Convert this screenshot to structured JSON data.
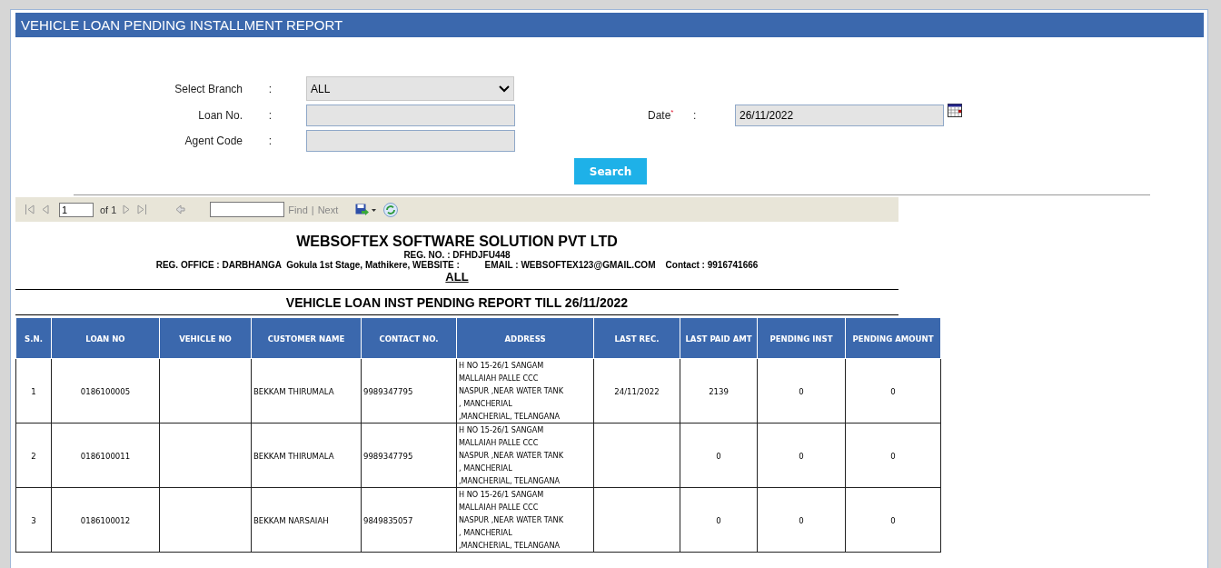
{
  "page_title": "VEHICLE LOAN PENDING INSTALLMENT REPORT",
  "form": {
    "branch": {
      "label": "Select Branch",
      "value": "ALL"
    },
    "loan_no": {
      "label": "Loan No."
    },
    "agent_code": {
      "label": "Agent Code"
    },
    "date": {
      "label": "Date",
      "required_mark": "*",
      "value": "26/11/2022"
    },
    "separator": ":",
    "search_button": "Search"
  },
  "toolbar": {
    "page": "1",
    "of_pages": "of 1",
    "find": "Find",
    "divider": "|",
    "next": "Next"
  },
  "report": {
    "company": "WEBSOFTEX SOFTWARE SOLUTION PVT LTD",
    "reg_no": "REG. NO. : DFHDJFU448",
    "office_line": "REG. OFFICE : DARBHANGA  Gokula 1st Stage, Mathikere, WEBSITE :          EMAIL : WEBSOFTEX123@GMAIL.COM    Contact : 9916741666",
    "branch": "ALL",
    "title": "VEHICLE LOAN INST PENDING REPORT TILL 26/11/2022",
    "columns": [
      "S.N.",
      "LOAN NO",
      "VEHICLE NO",
      "CUSTOMER NAME",
      "CONTACT NO.",
      "ADDRESS",
      "LAST REC.",
      "LAST PAID AMT",
      "PENDING INST",
      "PENDING AMOUNT"
    ],
    "rows": [
      [
        "1",
        "0186100005",
        "",
        "BEKKAM THIRUMALA",
        "9989347795",
        "H NO 15-26/1 SANGAM\nMALLAIAH PALLE CCC\nNASPUR ,NEAR WATER TANK\n, MANCHERIAL\n,MANCHERIAL, TELANGANA",
        "24/11/2022",
        "2139",
        "0",
        "0"
      ],
      [
        "2",
        "0186100011",
        "",
        "BEKKAM THIRUMALA",
        "9989347795",
        "H NO 15-26/1 SANGAM\nMALLAIAH PALLE CCC\nNASPUR ,NEAR WATER TANK\n, MANCHERIAL\n,MANCHERIAL, TELANGANA",
        "",
        "0",
        "0",
        "0"
      ],
      [
        "3",
        "0186100012",
        "",
        "BEKKAM NARSAIAH",
        "9849835057",
        "H NO 15-26/1 SANGAM\nMALLAIAH PALLE CCC\nNASPUR ,NEAR WATER TANK\n, MANCHERIAL\n,MANCHERIAL, TELANGANA",
        "",
        "0",
        "0",
        "0"
      ]
    ]
  }
}
